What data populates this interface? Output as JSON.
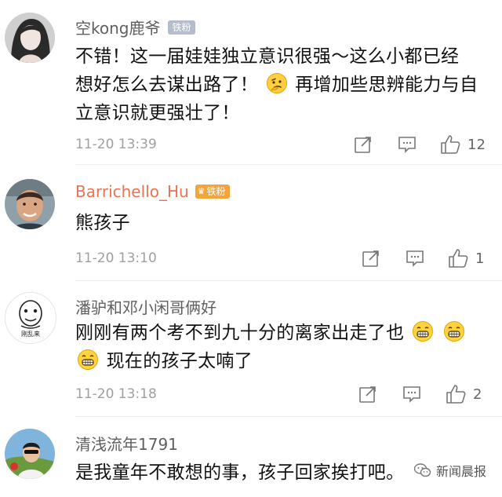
{
  "comments": [
    {
      "username": "空kong鹿爷",
      "badge": "铁粉",
      "text_lines": [
        "不错！这一届娃娃独立意识很强～这么小都已经",
        "想好怎么去谋出路了！",
        "再增加些思辨能力与自",
        "立意识就更强壮了！"
      ],
      "timestamp": "11-20 13:39",
      "likes": "12"
    },
    {
      "username": "Barrichello_Hu",
      "badge": "铁粉",
      "text_lines": [
        "熊孩子"
      ],
      "timestamp": "11-20 13:10",
      "likes": "1"
    },
    {
      "username": "潘驴和邓小闲哥俩好",
      "avatar_caption": "刚乱来",
      "text_lines": [
        "刚刚有两个考不到九十分的离家出走了也",
        "现在的孩子太喃了"
      ],
      "timestamp": "11-20 13:18",
      "likes": "2"
    },
    {
      "username": "清浅流年1791",
      "text_lines": [
        "是我童年不敢想的事，孩子回家挨打吧。"
      ]
    }
  ],
  "watermark": "新闻晨报",
  "colors": {
    "username": "#5f5f5f",
    "vip_username": "#eb7350",
    "badge": "#b5bccb",
    "meta": "#a0a0a0"
  }
}
